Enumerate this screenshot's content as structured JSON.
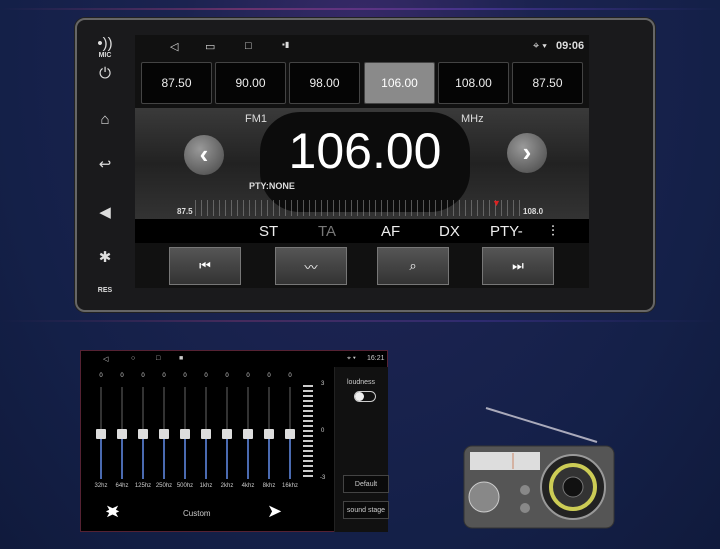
{
  "side": {
    "mic": "MIC",
    "res": "RES"
  },
  "status": {
    "time": "09:06"
  },
  "presets": [
    "87.50",
    "90.00",
    "98.00",
    "106.00",
    "108.00",
    "87.50"
  ],
  "display": {
    "band": "FM1",
    "frequency": "106.00",
    "unit": "MHz",
    "pty": "PTY:NONE",
    "scale_min": "87.5",
    "scale_max": "108.0",
    "tuned_fraction": 0.9
  },
  "toolbar": {
    "st": "ST",
    "ta": "TA",
    "af": "AF",
    "dx": "DX",
    "pty": "PTY-"
  },
  "eq": {
    "time": "16:21",
    "bands": [
      {
        "f": "32hz",
        "v": "0"
      },
      {
        "f": "64hz",
        "v": "0"
      },
      {
        "f": "125hz",
        "v": "0"
      },
      {
        "f": "250hz",
        "v": "0"
      },
      {
        "f": "500hz",
        "v": "0"
      },
      {
        "f": "1khz",
        "v": "0"
      },
      {
        "f": "2khz",
        "v": "0"
      },
      {
        "f": "4khz",
        "v": "0"
      },
      {
        "f": "8khz",
        "v": "0"
      },
      {
        "f": "16khz",
        "v": "0"
      }
    ],
    "scale_top": "3",
    "scale_mid": "0",
    "scale_bottom": "-3",
    "preset": "Custom",
    "loudness": "loudness",
    "default": "Default",
    "sound_stage": "sound stage"
  }
}
